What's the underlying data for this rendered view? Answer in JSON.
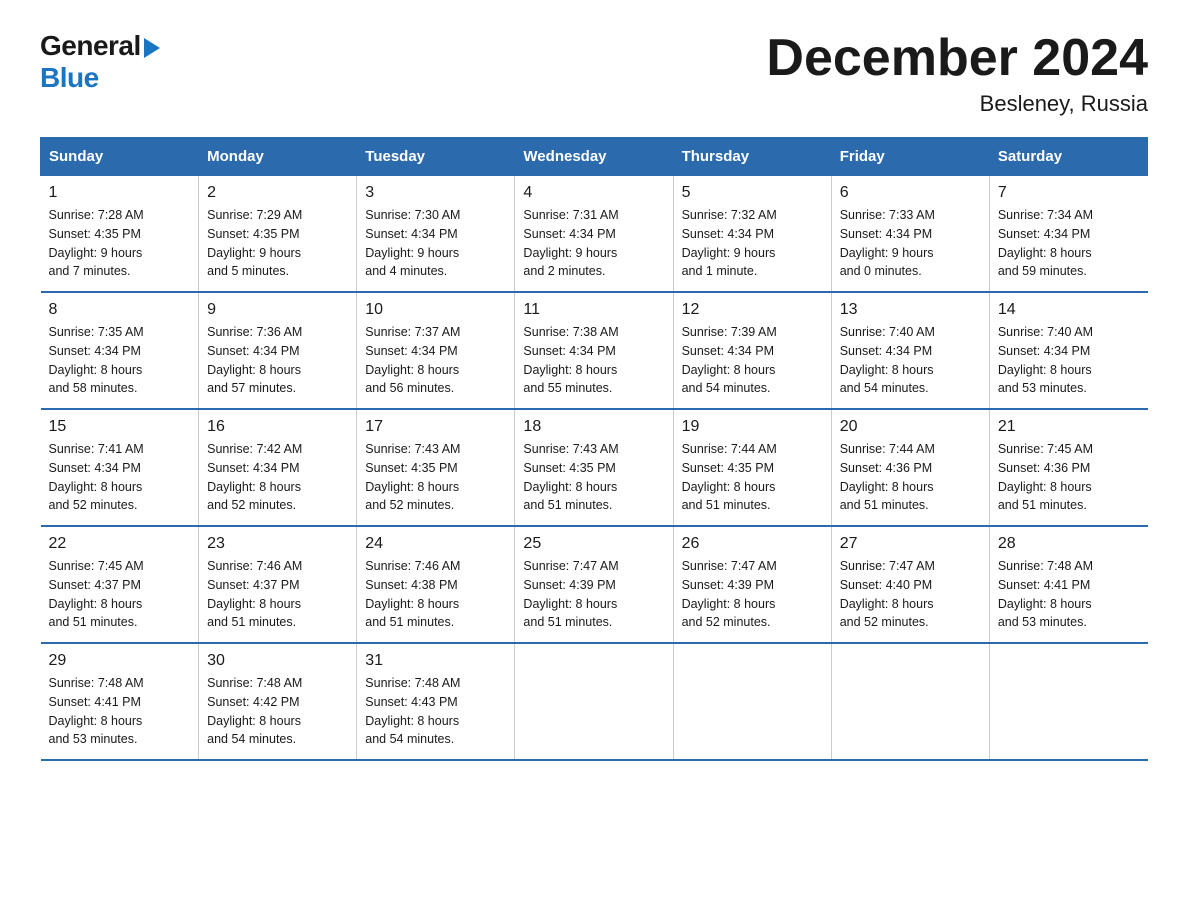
{
  "header": {
    "logo_general": "General",
    "logo_blue": "Blue",
    "month_title": "December 2024",
    "location": "Besleney, Russia"
  },
  "days_of_week": [
    "Sunday",
    "Monday",
    "Tuesday",
    "Wednesday",
    "Thursday",
    "Friday",
    "Saturday"
  ],
  "weeks": [
    [
      {
        "day": "1",
        "sunrise": "Sunrise: 7:28 AM",
        "sunset": "Sunset: 4:35 PM",
        "daylight": "Daylight: 9 hours",
        "daylight2": "and 7 minutes."
      },
      {
        "day": "2",
        "sunrise": "Sunrise: 7:29 AM",
        "sunset": "Sunset: 4:35 PM",
        "daylight": "Daylight: 9 hours",
        "daylight2": "and 5 minutes."
      },
      {
        "day": "3",
        "sunrise": "Sunrise: 7:30 AM",
        "sunset": "Sunset: 4:34 PM",
        "daylight": "Daylight: 9 hours",
        "daylight2": "and 4 minutes."
      },
      {
        "day": "4",
        "sunrise": "Sunrise: 7:31 AM",
        "sunset": "Sunset: 4:34 PM",
        "daylight": "Daylight: 9 hours",
        "daylight2": "and 2 minutes."
      },
      {
        "day": "5",
        "sunrise": "Sunrise: 7:32 AM",
        "sunset": "Sunset: 4:34 PM",
        "daylight": "Daylight: 9 hours",
        "daylight2": "and 1 minute."
      },
      {
        "day": "6",
        "sunrise": "Sunrise: 7:33 AM",
        "sunset": "Sunset: 4:34 PM",
        "daylight": "Daylight: 9 hours",
        "daylight2": "and 0 minutes."
      },
      {
        "day": "7",
        "sunrise": "Sunrise: 7:34 AM",
        "sunset": "Sunset: 4:34 PM",
        "daylight": "Daylight: 8 hours",
        "daylight2": "and 59 minutes."
      }
    ],
    [
      {
        "day": "8",
        "sunrise": "Sunrise: 7:35 AM",
        "sunset": "Sunset: 4:34 PM",
        "daylight": "Daylight: 8 hours",
        "daylight2": "and 58 minutes."
      },
      {
        "day": "9",
        "sunrise": "Sunrise: 7:36 AM",
        "sunset": "Sunset: 4:34 PM",
        "daylight": "Daylight: 8 hours",
        "daylight2": "and 57 minutes."
      },
      {
        "day": "10",
        "sunrise": "Sunrise: 7:37 AM",
        "sunset": "Sunset: 4:34 PM",
        "daylight": "Daylight: 8 hours",
        "daylight2": "and 56 minutes."
      },
      {
        "day": "11",
        "sunrise": "Sunrise: 7:38 AM",
        "sunset": "Sunset: 4:34 PM",
        "daylight": "Daylight: 8 hours",
        "daylight2": "and 55 minutes."
      },
      {
        "day": "12",
        "sunrise": "Sunrise: 7:39 AM",
        "sunset": "Sunset: 4:34 PM",
        "daylight": "Daylight: 8 hours",
        "daylight2": "and 54 minutes."
      },
      {
        "day": "13",
        "sunrise": "Sunrise: 7:40 AM",
        "sunset": "Sunset: 4:34 PM",
        "daylight": "Daylight: 8 hours",
        "daylight2": "and 54 minutes."
      },
      {
        "day": "14",
        "sunrise": "Sunrise: 7:40 AM",
        "sunset": "Sunset: 4:34 PM",
        "daylight": "Daylight: 8 hours",
        "daylight2": "and 53 minutes."
      }
    ],
    [
      {
        "day": "15",
        "sunrise": "Sunrise: 7:41 AM",
        "sunset": "Sunset: 4:34 PM",
        "daylight": "Daylight: 8 hours",
        "daylight2": "and 52 minutes."
      },
      {
        "day": "16",
        "sunrise": "Sunrise: 7:42 AM",
        "sunset": "Sunset: 4:34 PM",
        "daylight": "Daylight: 8 hours",
        "daylight2": "and 52 minutes."
      },
      {
        "day": "17",
        "sunrise": "Sunrise: 7:43 AM",
        "sunset": "Sunset: 4:35 PM",
        "daylight": "Daylight: 8 hours",
        "daylight2": "and 52 minutes."
      },
      {
        "day": "18",
        "sunrise": "Sunrise: 7:43 AM",
        "sunset": "Sunset: 4:35 PM",
        "daylight": "Daylight: 8 hours",
        "daylight2": "and 51 minutes."
      },
      {
        "day": "19",
        "sunrise": "Sunrise: 7:44 AM",
        "sunset": "Sunset: 4:35 PM",
        "daylight": "Daylight: 8 hours",
        "daylight2": "and 51 minutes."
      },
      {
        "day": "20",
        "sunrise": "Sunrise: 7:44 AM",
        "sunset": "Sunset: 4:36 PM",
        "daylight": "Daylight: 8 hours",
        "daylight2": "and 51 minutes."
      },
      {
        "day": "21",
        "sunrise": "Sunrise: 7:45 AM",
        "sunset": "Sunset: 4:36 PM",
        "daylight": "Daylight: 8 hours",
        "daylight2": "and 51 minutes."
      }
    ],
    [
      {
        "day": "22",
        "sunrise": "Sunrise: 7:45 AM",
        "sunset": "Sunset: 4:37 PM",
        "daylight": "Daylight: 8 hours",
        "daylight2": "and 51 minutes."
      },
      {
        "day": "23",
        "sunrise": "Sunrise: 7:46 AM",
        "sunset": "Sunset: 4:37 PM",
        "daylight": "Daylight: 8 hours",
        "daylight2": "and 51 minutes."
      },
      {
        "day": "24",
        "sunrise": "Sunrise: 7:46 AM",
        "sunset": "Sunset: 4:38 PM",
        "daylight": "Daylight: 8 hours",
        "daylight2": "and 51 minutes."
      },
      {
        "day": "25",
        "sunrise": "Sunrise: 7:47 AM",
        "sunset": "Sunset: 4:39 PM",
        "daylight": "Daylight: 8 hours",
        "daylight2": "and 51 minutes."
      },
      {
        "day": "26",
        "sunrise": "Sunrise: 7:47 AM",
        "sunset": "Sunset: 4:39 PM",
        "daylight": "Daylight: 8 hours",
        "daylight2": "and 52 minutes."
      },
      {
        "day": "27",
        "sunrise": "Sunrise: 7:47 AM",
        "sunset": "Sunset: 4:40 PM",
        "daylight": "Daylight: 8 hours",
        "daylight2": "and 52 minutes."
      },
      {
        "day": "28",
        "sunrise": "Sunrise: 7:48 AM",
        "sunset": "Sunset: 4:41 PM",
        "daylight": "Daylight: 8 hours",
        "daylight2": "and 53 minutes."
      }
    ],
    [
      {
        "day": "29",
        "sunrise": "Sunrise: 7:48 AM",
        "sunset": "Sunset: 4:41 PM",
        "daylight": "Daylight: 8 hours",
        "daylight2": "and 53 minutes."
      },
      {
        "day": "30",
        "sunrise": "Sunrise: 7:48 AM",
        "sunset": "Sunset: 4:42 PM",
        "daylight": "Daylight: 8 hours",
        "daylight2": "and 54 minutes."
      },
      {
        "day": "31",
        "sunrise": "Sunrise: 7:48 AM",
        "sunset": "Sunset: 4:43 PM",
        "daylight": "Daylight: 8 hours",
        "daylight2": "and 54 minutes."
      },
      null,
      null,
      null,
      null
    ]
  ]
}
